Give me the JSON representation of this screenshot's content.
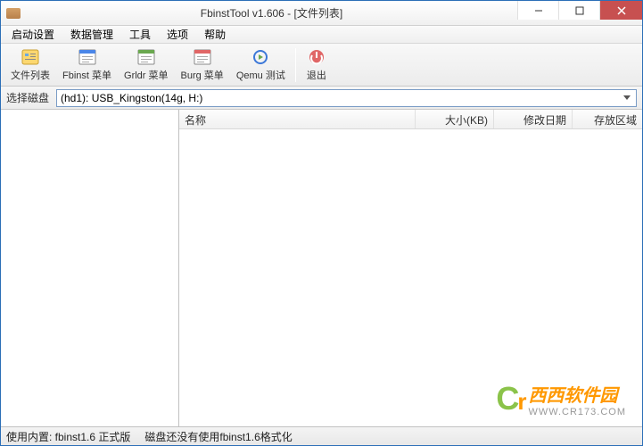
{
  "title": "FbinstTool v1.606 - [文件列表]",
  "menu": [
    "启动设置",
    "数据管理",
    "工具",
    "选项",
    "帮助"
  ],
  "toolbar": {
    "fileList": "文件列表",
    "fbinstMenu": "Fbinst 菜单",
    "grldrMenu": "Grldr 菜单",
    "burgMenu": "Burg 菜单",
    "qemuTest": "Qemu 测试",
    "exit": "退出"
  },
  "diskRow": {
    "label": "选择磁盘",
    "selected": "(hd1): USB_Kingston(14g, H:)"
  },
  "columns": {
    "name": "名称",
    "size": "大小(KB)",
    "date": "修改日期",
    "area": "存放区域"
  },
  "status": {
    "kernel": "使用内置: fbinst1.6 正式版",
    "msg": "磁盘还没有使用fbinst1.6格式化"
  },
  "watermark": {
    "logo1": "C",
    "logo2": "r",
    "text": "西西软件园",
    "url": "WWW.CR173.COM"
  }
}
